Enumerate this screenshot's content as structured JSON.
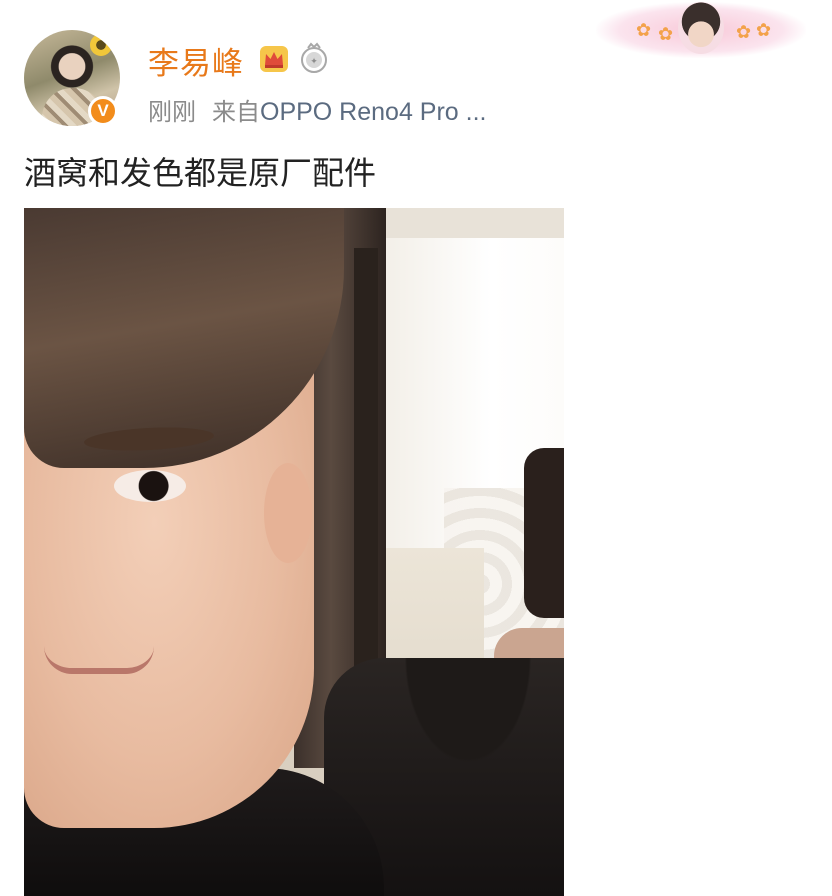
{
  "post": {
    "username": "李易峰",
    "verified_badge": "V",
    "time": "刚刚",
    "source_prefix": "来自",
    "device": "OPPO Reno4 Pro ...",
    "text": "酒窝和发色都是原厂配件"
  },
  "icons": {
    "verified": "verified-v-icon",
    "crown": "crown-icon",
    "vip": "vip-badge-icon"
  },
  "colors": {
    "username": "#e8791a",
    "meta": "#8b8b8b",
    "device": "#5b6b80",
    "verified_badge": "#f28c1b",
    "post_text": "#222222"
  }
}
